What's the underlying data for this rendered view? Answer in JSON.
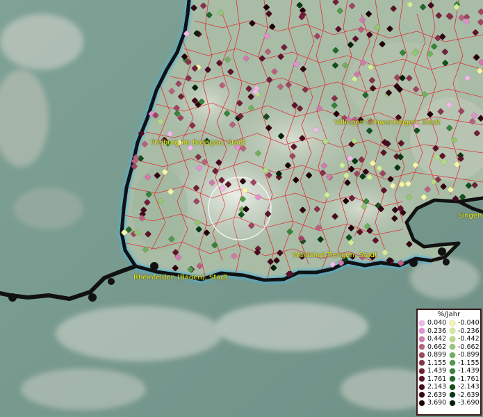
{
  "map": {
    "cities": [
      {
        "id": "freiburg",
        "label": "Freiburg im Breisgau, Stadt"
      },
      {
        "id": "villingen",
        "label": "Villingen-Schwenningen, Stadt"
      },
      {
        "id": "singen",
        "label": "Singen"
      },
      {
        "id": "waldshut",
        "label": "Waldshut-Tiengen, Stadt"
      },
      {
        "id": "rheinfelden",
        "label": "Rheinfelden (Baden), Stadt"
      }
    ]
  },
  "legend": {
    "title": "%/Jahr",
    "positive": [
      {
        "value": "0.040",
        "color": "#f2b8ea"
      },
      {
        "value": "0.236",
        "color": "#e58fcf"
      },
      {
        "value": "0.442",
        "color": "#d17aab"
      },
      {
        "value": "0.662",
        "color": "#b9607f"
      },
      {
        "value": "0.899",
        "color": "#9f4562"
      },
      {
        "value": "1.155",
        "color": "#87324a"
      },
      {
        "value": "1.439",
        "color": "#70213a"
      },
      {
        "value": "1.761",
        "color": "#5c132b"
      },
      {
        "value": "2.143",
        "color": "#470a1f"
      },
      {
        "value": "2.639",
        "color": "#320514"
      },
      {
        "value": "3.690",
        "color": "#200009"
      }
    ],
    "negative": [
      {
        "value": "-0.040",
        "color": "#f3f6a8"
      },
      {
        "value": "-0.236",
        "color": "#d2ec98"
      },
      {
        "value": "-0.442",
        "color": "#b5dc85"
      },
      {
        "value": "-0.662",
        "color": "#93c772"
      },
      {
        "value": "-0.899",
        "color": "#71b05f"
      },
      {
        "value": "-1.155",
        "color": "#519a4b"
      },
      {
        "value": "-1.439",
        "color": "#38823a"
      },
      {
        "value": "-1.761",
        "color": "#22692a"
      },
      {
        "value": "-2.143",
        "color": "#13501d"
      },
      {
        "value": "-2.639",
        "color": "#083812"
      },
      {
        "value": "-3.690",
        "color": "#022108"
      }
    ]
  }
}
